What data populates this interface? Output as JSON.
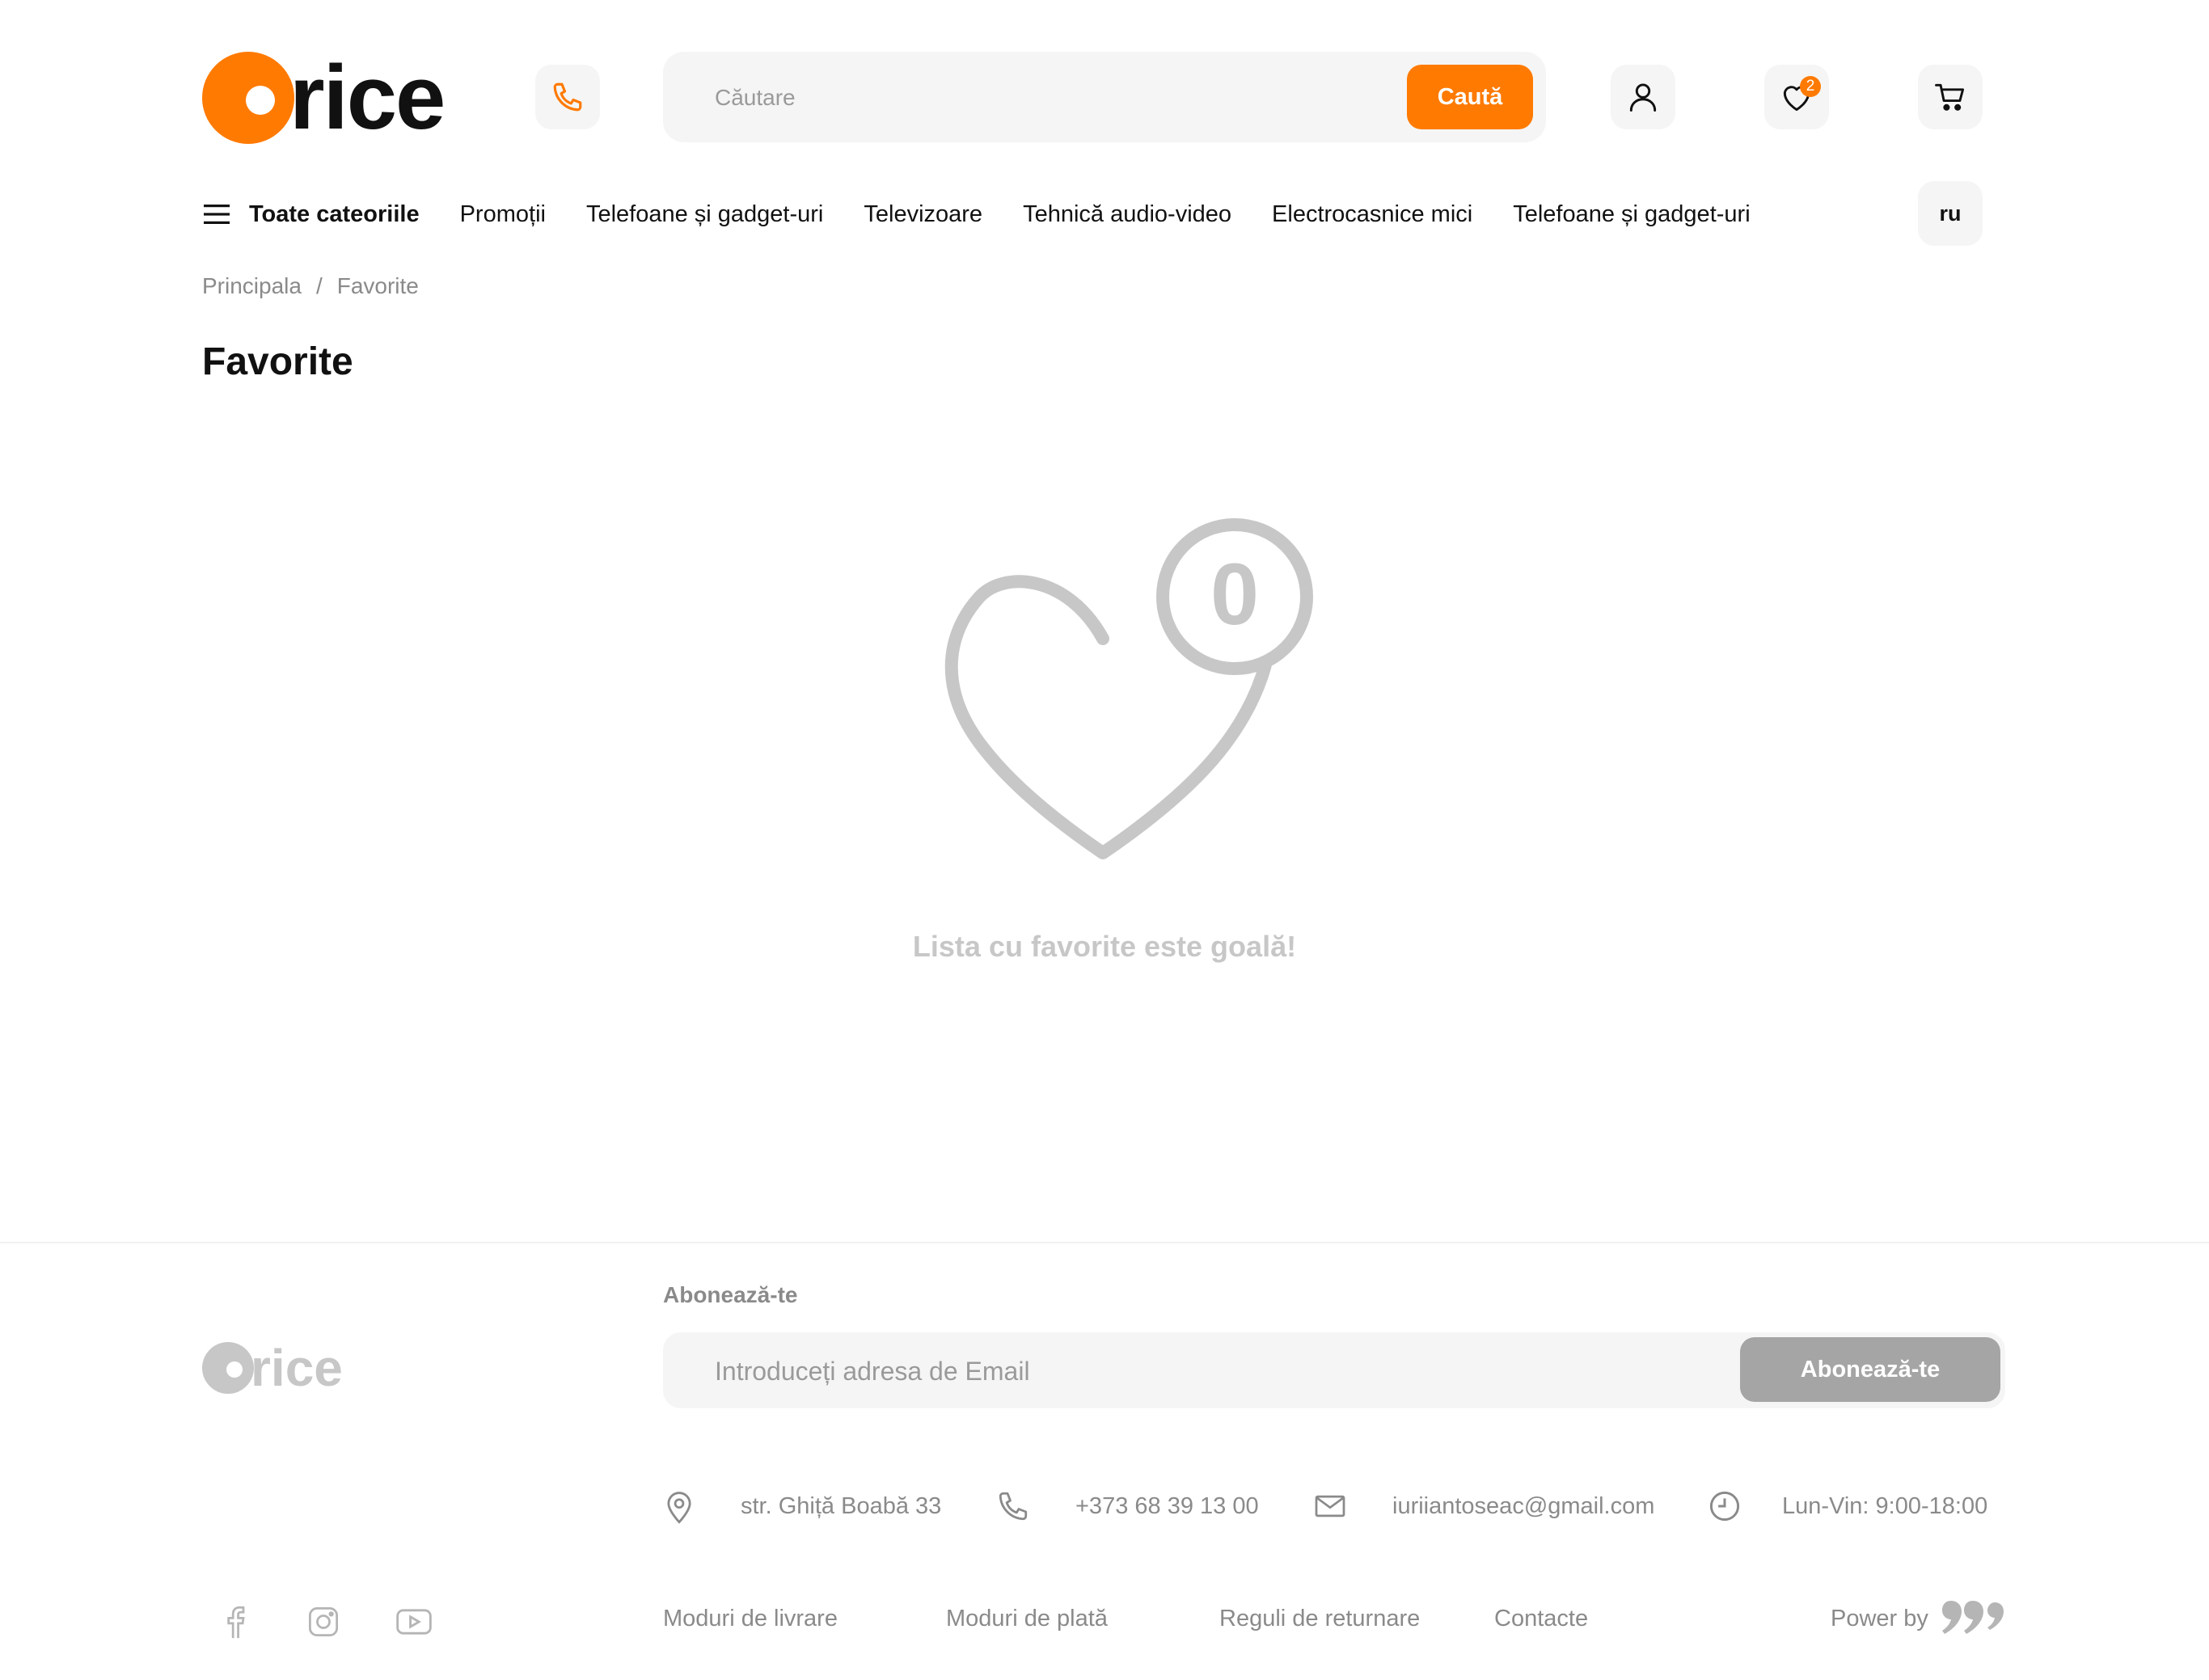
{
  "brand": {
    "logo_text": "rice",
    "accent": "#FF7A00"
  },
  "header": {
    "search_placeholder": "Căutare",
    "search_button": "Caută",
    "favorites_count": "2",
    "icons": [
      "phone-icon",
      "user-icon",
      "heart-icon",
      "cart-icon"
    ]
  },
  "nav": {
    "all_categories": "Toate cateoriile",
    "items": [
      "Promoții",
      "Telefoane și gadget-uri",
      "Televizoare",
      "Tehnică audio-video",
      "Electrocasnice mici",
      "Telefoane și gadget-uri"
    ],
    "language": "ru"
  },
  "breadcrumb": {
    "home": "Principala",
    "separator": "/",
    "current": "Favorite"
  },
  "page": {
    "title": "Favorite",
    "empty_count": "0",
    "empty_message": "Lista cu favorite este goală!"
  },
  "footer": {
    "logo_text": "rice",
    "subscribe_label": "Abonează-te",
    "email_placeholder": "Introduceți adresa de Email",
    "subscribe_button": "Abonează-te",
    "address": "str. Ghiță Boabă 33",
    "phone": "+373 68 39 13 00",
    "email": "iuriiantoseac@gmail.com",
    "hours": "Lun-Vin: 9:00-18:00",
    "links": [
      "Moduri de livrare",
      "Moduri de plată",
      "Reguli de returnare",
      "Contacte"
    ],
    "social_icons": [
      "facebook-icon",
      "instagram-icon",
      "youtube-icon"
    ],
    "powered_by": "Power by"
  }
}
